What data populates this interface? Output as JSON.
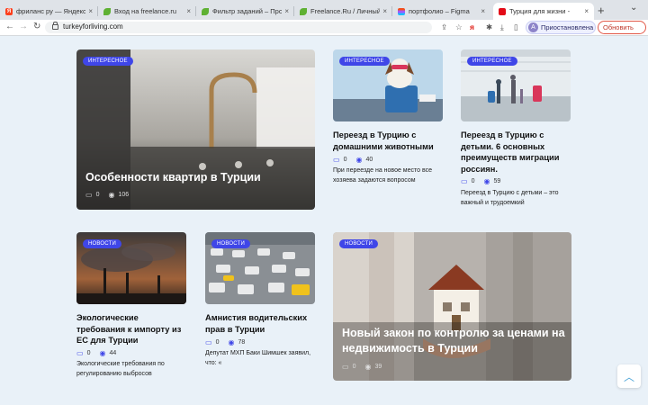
{
  "browser": {
    "tabs": [
      {
        "title": "фриланс ру — Яндекс: наш",
        "active": false
      },
      {
        "title": "Вход на freelance.ru",
        "active": false
      },
      {
        "title": "Фильтр заданий – Проекты",
        "active": false
      },
      {
        "title": "Freelance.Ru / Личный каб",
        "active": false
      },
      {
        "title": "портфолио – Figma",
        "active": false
      },
      {
        "title": "Турция для жизни -",
        "active": true
      }
    ],
    "close_glyph": "×",
    "new_tab_glyph": "+",
    "url": "turkeyforliving.com",
    "profile": {
      "initial": "А",
      "label": "Приостановлена"
    },
    "update_label": "Обновить",
    "accent": "#3f46e8"
  },
  "articles": {
    "feature": {
      "badge": "ИНТЕРЕСНОЕ",
      "title": "Особенности квартир в Турции",
      "comments": "0",
      "views": "106"
    },
    "pets": {
      "badge": "ИНТЕРЕСНОЕ",
      "title": "Переезд в Турцию с домашними животными",
      "comments": "0",
      "views": "40",
      "excerpt": "При переезде на новое место все хозяева задаются вопросом"
    },
    "kids": {
      "badge": "ИНТЕРЕСНОЕ",
      "title": "Переезд в Турцию с детьми. 6 основных преимуществ миграции россиян.",
      "comments": "0",
      "views": "59",
      "excerpt": "Переезд в Турцию с детьми – это важный и трудоемкий"
    },
    "eco": {
      "badge": "НОВОСТИ",
      "title": "Экологические требования к импорту из ЕС для Турции",
      "comments": "0",
      "views": "44",
      "excerpt": "Экологические требования по регулированию выбросов"
    },
    "amnesty": {
      "badge": "НОВОСТИ",
      "title": "Амнистия водительских прав в Турции",
      "comments": "0",
      "views": "78",
      "excerpt": "Депутат МХП Баки Шимшек заявил, что: «"
    },
    "law": {
      "badge": "НОВОСТИ",
      "title": "Новый закон по контролю за ценами на недвижимость в Турции",
      "comments": "0",
      "views": "39"
    }
  }
}
